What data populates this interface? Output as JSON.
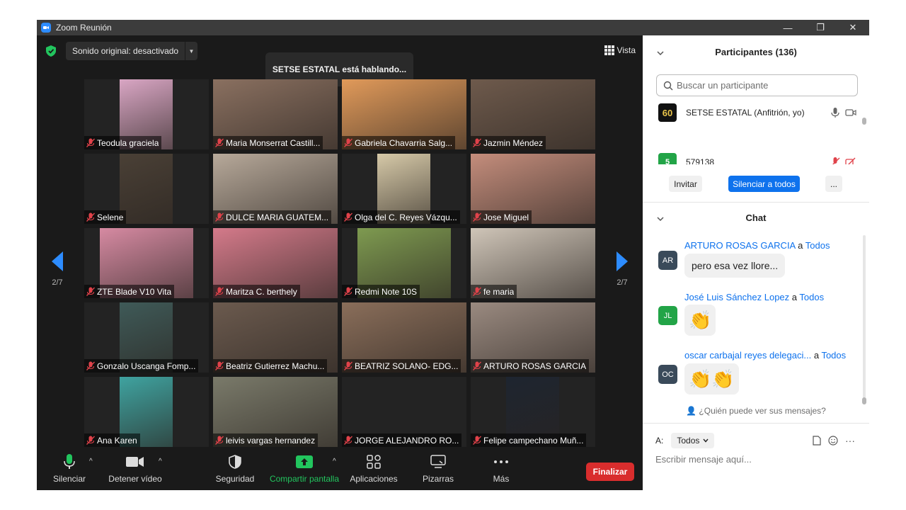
{
  "window": {
    "title": "Zoom Reunión",
    "minimize": "—",
    "restore": "❐",
    "close": "✕"
  },
  "video": {
    "audio_label": "Sonido original: desactivado",
    "audio_caret": "▼",
    "speaking": "SETSE ESTATAL está hablando...",
    "view_label": "Vista",
    "page_left": "2/7",
    "page_right": "2/7"
  },
  "tiles": [
    {
      "name": "Teodula graciela",
      "feed": "#d9a6c4"
    },
    {
      "name": "Maria Monserrat Castill...",
      "feed": "#8a7060"
    },
    {
      "name": "Gabriela Chavarria Salg...",
      "feed": "#e19a5a"
    },
    {
      "name": "Jazmin Méndez",
      "feed": "#6e5a4c"
    },
    {
      "name": "Selene",
      "feed": "#4a4036"
    },
    {
      "name": "DULCE MARIA GUATEM...",
      "feed": "#b7a99a"
    },
    {
      "name": "Olga del C. Reyes Vázqu...",
      "feed": "#d6c9a8"
    },
    {
      "name": "Jose Miguel",
      "feed": "#c48d7c"
    },
    {
      "name": "ZTE Blade V10 Vita",
      "feed": "#d68aa2"
    },
    {
      "name": "Maritza C. berthely",
      "feed": "#d47a8a"
    },
    {
      "name": "Redmi Note 10S",
      "feed": "#7e9a50"
    },
    {
      "name": "fe maria",
      "feed": "#cfc5b8"
    },
    {
      "name": "Gonzalo Uscanga Fomp...",
      "feed": "#3f5a58"
    },
    {
      "name": "Beatriz Gutierrez Machu...",
      "feed": "#6b5a4e"
    },
    {
      "name": "BEATRIZ SOLANO- EDG...",
      "feed": "#8a6e5a"
    },
    {
      "name": "ARTURO ROSAS GARCIA",
      "feed": "#9a8a80"
    },
    {
      "name": "Ana Karen",
      "feed": "#3fa3a0"
    },
    {
      "name": "leivis vargas hernandez",
      "feed": "#7a7a6a"
    },
    {
      "name": "JORGE ALEJANDRO RO...",
      "feed": "#232323"
    },
    {
      "name": "Felipe campechano Muñ...",
      "feed": "#1e2530"
    }
  ],
  "toolbar": {
    "mute": "Silenciar",
    "stop_video": "Detener vídeo",
    "security": "Seguridad",
    "share": "Compartir pantalla",
    "apps": "Aplicaciones",
    "whiteboards": "Pizarras",
    "more": "Más",
    "end": "Finalizar",
    "caret": "^"
  },
  "participants": {
    "header": "Participantes (136)",
    "search_placeholder": "Buscar un participante",
    "list": [
      {
        "name": "SETSE ESTATAL (Anfitrión, yo)",
        "avatar": "60"
      },
      {
        "name": "579138",
        "avatar": "5"
      }
    ],
    "invite": "Invitar",
    "mute_all": "Silenciar a todos",
    "more": "..."
  },
  "chat": {
    "header": "Chat",
    "to_word": "a",
    "messages": [
      {
        "sender": "ARTURO ROSAS GARCIA",
        "to": "Todos",
        "initials": "AR",
        "text": "pero esa vez llore...",
        "color": "#3a4a5a"
      },
      {
        "sender": "José Luis Sánchez Lopez",
        "to": "Todos",
        "initials": "JL",
        "text": "👏",
        "color": "#22a447"
      },
      {
        "sender": "oscar carbajal reyes delegaci...",
        "to": "Todos",
        "initials": "OC",
        "text": "👏👏",
        "color": "#3a4a5a"
      }
    ],
    "who_can_see": "¿Quién puede ver sus mensajes?",
    "to_label": "A:",
    "to_value": "Todos",
    "compose_placeholder": "Escribir mensaje aquí...",
    "more": "···"
  }
}
